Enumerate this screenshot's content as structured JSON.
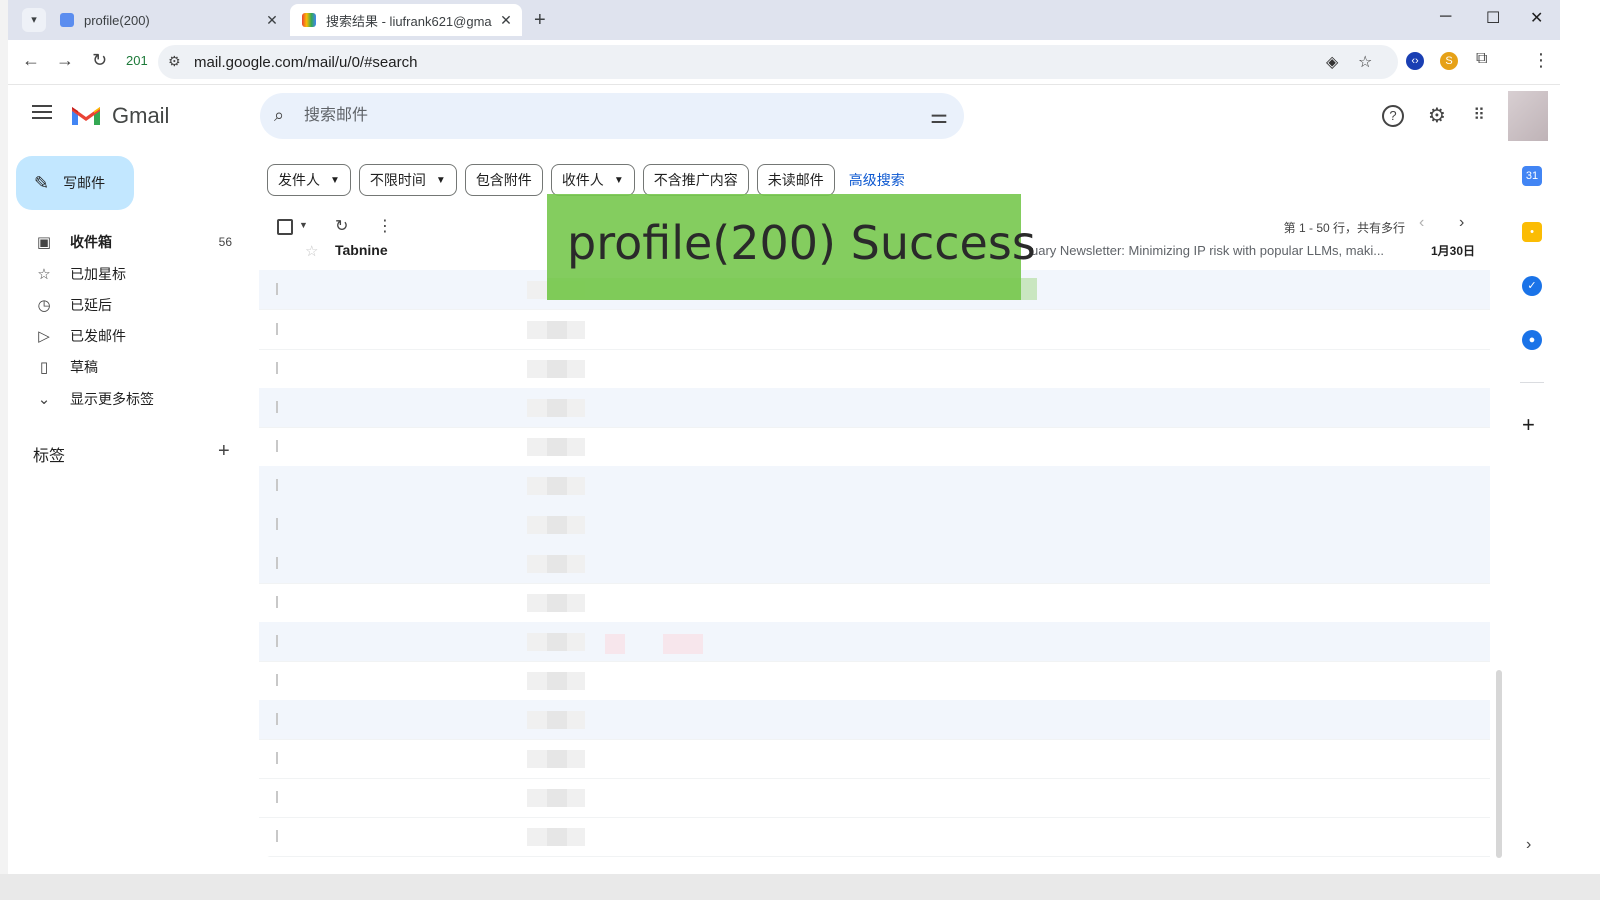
{
  "browser": {
    "tabs": [
      {
        "title": "profile(200)",
        "active": false
      },
      {
        "title": "搜索结果 - liufrank621@gma",
        "active": true
      }
    ],
    "reload_count": "201",
    "url": "mail.google.com/mail/u/0/#search"
  },
  "app": {
    "name": "Gmail"
  },
  "search": {
    "placeholder": "搜索邮件"
  },
  "compose": {
    "label": "写邮件"
  },
  "nav": [
    {
      "label": "收件箱",
      "count": "56",
      "icon": "inbox-icon",
      "bold": true
    },
    {
      "label": "已加星标",
      "count": "",
      "icon": "star-icon"
    },
    {
      "label": "已延后",
      "count": "",
      "icon": "clock-icon"
    },
    {
      "label": "已发邮件",
      "count": "",
      "icon": "send-icon"
    },
    {
      "label": "草稿",
      "count": "",
      "icon": "draft-icon"
    },
    {
      "label": "显示更多标签",
      "count": "",
      "icon": "chevron-down-icon"
    }
  ],
  "labels_header": "标签",
  "filters": [
    {
      "label": "发件人",
      "dropdown": true
    },
    {
      "label": "不限时间",
      "dropdown": true
    },
    {
      "label": "包含附件",
      "dropdown": false
    },
    {
      "label": "收件人",
      "dropdown": true
    },
    {
      "label": "不含推广内容",
      "dropdown": false
    },
    {
      "label": "未读邮件",
      "dropdown": false
    }
  ],
  "advanced_search": "高级搜索",
  "pagination": "第 1 - 50 行，共有多行",
  "first_row": {
    "sender": "Tabnine",
    "snippet": "uary Newsletter: Minimizing IP risk with popular LLMs, maki...",
    "date": "1月30日"
  },
  "overlay": {
    "text": "profile(200) Success",
    "color": "#77c84e"
  },
  "colors": {
    "compose_bg": "#c2e7ff",
    "search_bg": "#eaf1fb",
    "link": "#0b57d0",
    "row_shade": "#f2f6fc"
  }
}
